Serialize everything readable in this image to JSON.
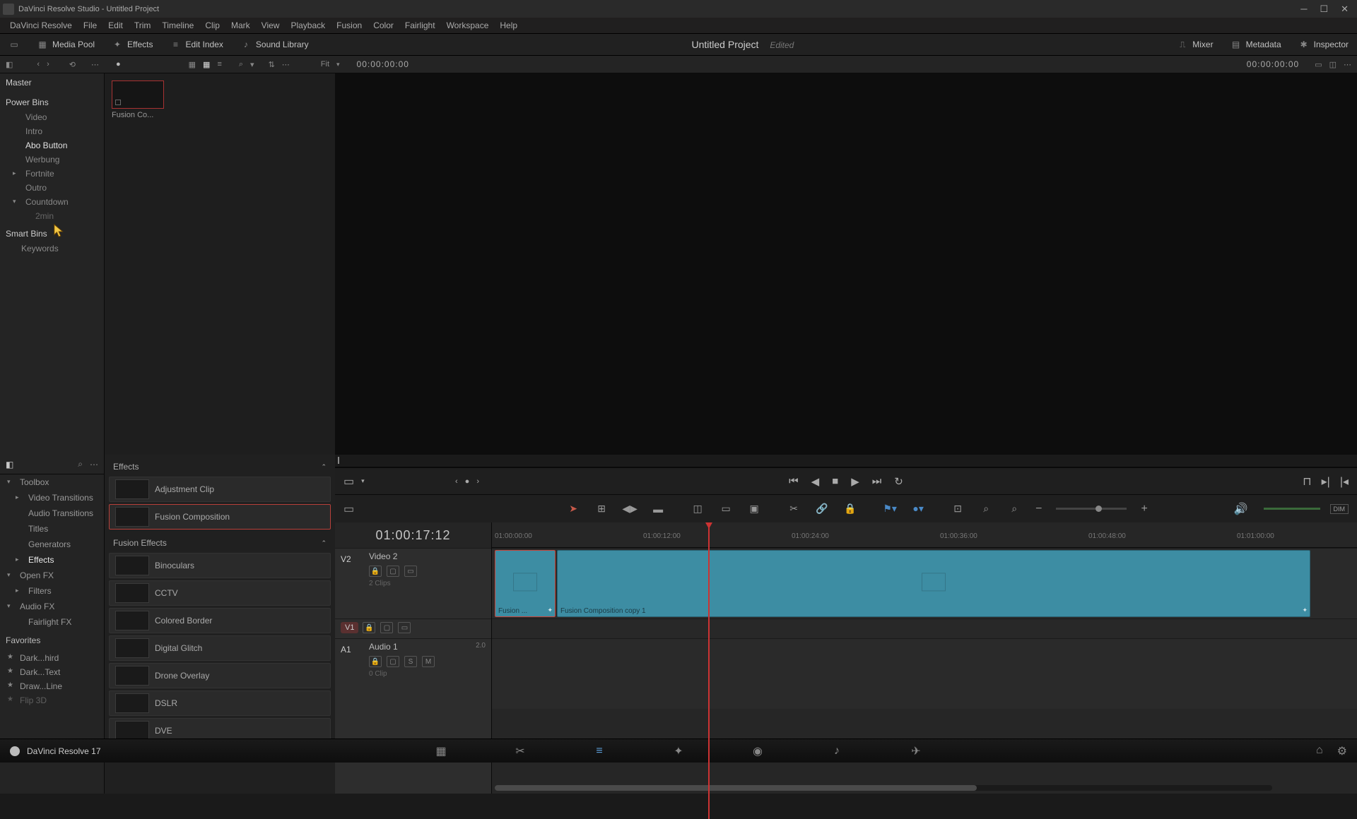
{
  "titlebar": {
    "title": "DaVinci Resolve Studio - Untitled Project"
  },
  "menu": [
    "DaVinci Resolve",
    "File",
    "Edit",
    "Trim",
    "Timeline",
    "Clip",
    "Mark",
    "View",
    "Playback",
    "Fusion",
    "Color",
    "Fairlight",
    "Workspace",
    "Help"
  ],
  "toolbar": {
    "media_pool": "Media Pool",
    "effects": "Effects",
    "edit_index": "Edit Index",
    "sound_library": "Sound Library",
    "project": "Untitled Project",
    "edited": "Edited",
    "mixer": "Mixer",
    "metadata": "Metadata",
    "inspector": "Inspector"
  },
  "shelf": {
    "fit": "Fit",
    "tc_left": "00:00:00:00",
    "tc_right": "00:00:00:00"
  },
  "media_side": {
    "master": "Master",
    "power_bins": "Power Bins",
    "bins": [
      {
        "label": "Video",
        "active": false
      },
      {
        "label": "Intro",
        "active": false
      },
      {
        "label": "Abo Button",
        "active": true
      },
      {
        "label": "Werbung",
        "active": false
      },
      {
        "label": "Fortnite",
        "active": false,
        "expandable": true
      },
      {
        "label": "Outro",
        "active": false
      },
      {
        "label": "Countdown",
        "active": false,
        "expanded": true
      },
      {
        "label": "2min",
        "active": false,
        "child": true
      }
    ],
    "smart_bins": "Smart Bins",
    "keywords": "Keywords"
  },
  "clip_bin": {
    "thumb_label": "Fusion Co..."
  },
  "fx_tree": {
    "items": [
      {
        "label": "Toolbox",
        "expanded": true
      },
      {
        "label": "Video Transitions",
        "lv": 2,
        "expandable": true
      },
      {
        "label": "Audio Transitions",
        "lv": 2
      },
      {
        "label": "Titles",
        "lv": 2
      },
      {
        "label": "Generators",
        "lv": 2
      },
      {
        "label": "Effects",
        "lv": 2,
        "active": true,
        "expandable": true
      },
      {
        "label": "Open FX",
        "expanded": true
      },
      {
        "label": "Filters",
        "lv": 2,
        "expandable": true
      },
      {
        "label": "Audio FX",
        "expanded": true
      },
      {
        "label": "Fairlight FX",
        "lv": 2
      }
    ],
    "favorites": "Favorites",
    "fav_items": [
      "Dark...hird",
      "Dark...Text",
      "Draw...Line",
      "Flip 3D"
    ]
  },
  "fx_list": {
    "cat1": "Effects",
    "cat1_items": [
      {
        "name": "Adjustment Clip",
        "sel": false
      },
      {
        "name": "Fusion Composition",
        "sel": true
      }
    ],
    "cat2": "Fusion Effects",
    "cat2_items": [
      {
        "name": "Binoculars"
      },
      {
        "name": "CCTV"
      },
      {
        "name": "Colored Border"
      },
      {
        "name": "Digital Glitch"
      },
      {
        "name": "Drone Overlay"
      },
      {
        "name": "DSLR"
      },
      {
        "name": "DVE"
      }
    ]
  },
  "timeline": {
    "tc": "01:00:17:12",
    "ruler": [
      "01:00:00:00",
      "01:00:12:00",
      "01:00:24:00",
      "01:00:36:00",
      "01:00:48:00",
      "01:01:00:00"
    ],
    "tracks": {
      "v2": {
        "id": "V2",
        "name": "Video 2",
        "clips_label": "2 Clips"
      },
      "v1": {
        "id": "V1"
      },
      "a1": {
        "id": "A1",
        "name": "Audio 1",
        "meter": "2.0",
        "clips_label": "0 Clip"
      }
    },
    "clips": [
      {
        "name": "Fusion ...",
        "sel": true
      },
      {
        "name": "Fusion Composition copy 1",
        "sel": false
      }
    ],
    "dim": "DIM"
  },
  "bottom": {
    "app_label": "DaVinci Resolve 17"
  }
}
